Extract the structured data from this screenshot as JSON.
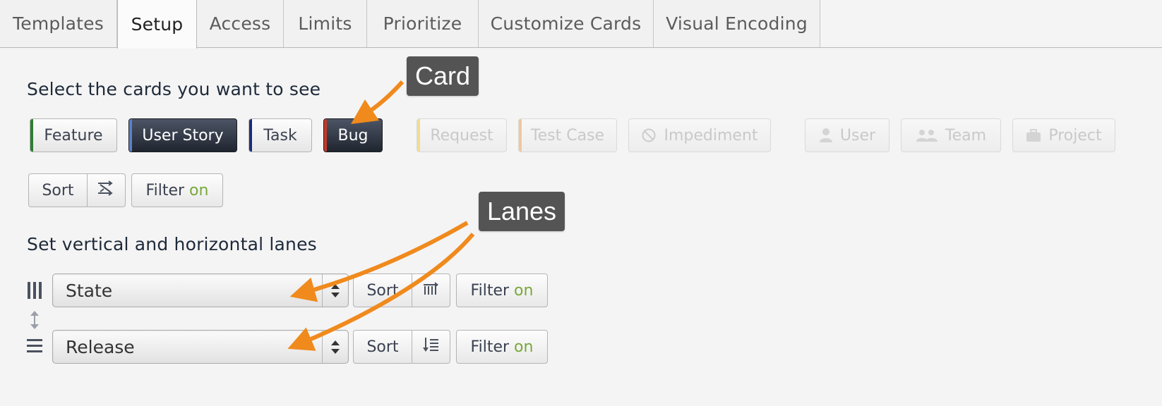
{
  "tabs": [
    {
      "label": "Templates"
    },
    {
      "label": "Setup"
    },
    {
      "label": "Access"
    },
    {
      "label": "Limits"
    },
    {
      "label": "Prioritize"
    },
    {
      "label": "Customize Cards"
    },
    {
      "label": "Visual Encoding"
    }
  ],
  "cards_section": {
    "heading": "Select the cards you want to see",
    "card_types": [
      {
        "label": "Feature",
        "stripe": "#2e7d32",
        "state": "unselected"
      },
      {
        "label": "User Story",
        "stripe": "#5b7fc9",
        "state": "selected"
      },
      {
        "label": "Task",
        "stripe": "#1d2d7a",
        "state": "unselected"
      },
      {
        "label": "Bug",
        "stripe": "#c0392b",
        "state": "selected"
      },
      {
        "label": "Request",
        "stripe": "#f3dc8c",
        "state": "disabled"
      },
      {
        "label": "Test Case",
        "stripe": "#f0c89a",
        "state": "disabled"
      },
      {
        "label": "Impediment",
        "icon": "ban-icon",
        "state": "disabled"
      },
      {
        "label": "User",
        "icon": "user-icon",
        "state": "disabled"
      },
      {
        "label": "Team",
        "icon": "team-icon",
        "state": "disabled"
      },
      {
        "label": "Project",
        "icon": "briefcase-icon",
        "state": "disabled"
      }
    ],
    "sort_label": "Sort",
    "filter_label": "Filter",
    "filter_state": "on"
  },
  "lanes_section": {
    "heading": "Set vertical and horizontal lanes",
    "vertical_lane": {
      "value": "State",
      "sort_label": "Sort",
      "filter_label": "Filter",
      "filter_state": "on"
    },
    "horizontal_lane": {
      "value": "Release",
      "sort_label": "Sort",
      "filter_label": "Filter",
      "filter_state": "on"
    }
  },
  "callouts": {
    "card": "Card",
    "lanes": "Lanes"
  },
  "colors": {
    "accent_on": "#78a83a",
    "callout_bg": "#545454",
    "arrow": "#f08a1d",
    "selected_button": "#2b313c"
  }
}
